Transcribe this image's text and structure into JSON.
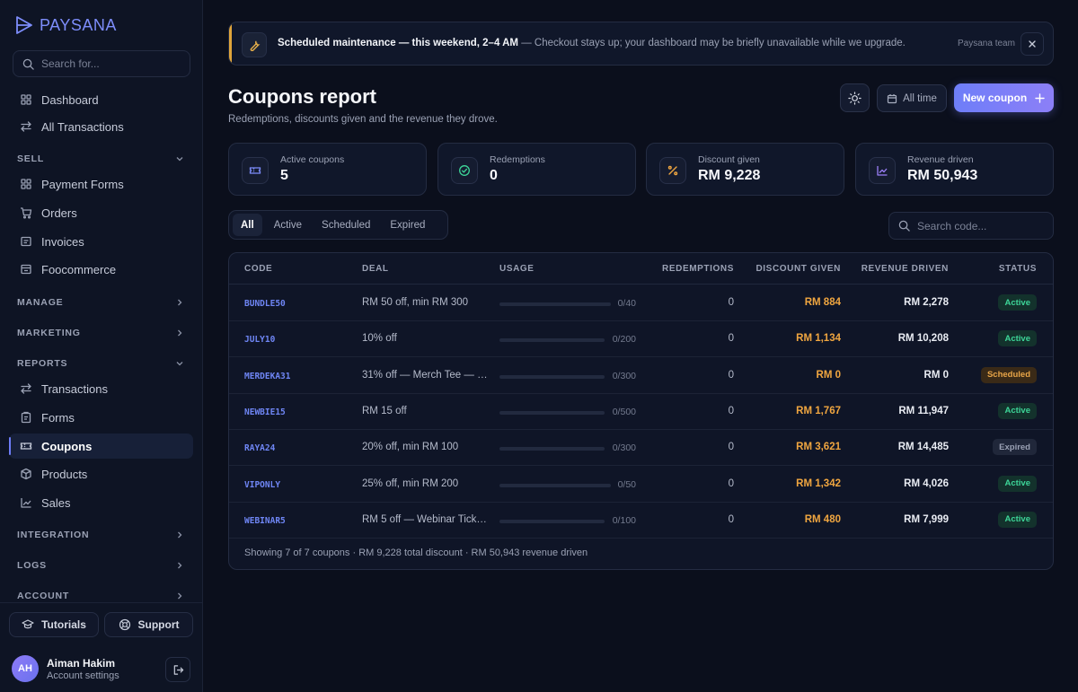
{
  "brand": {
    "name": "PAYSANA"
  },
  "sidebar": {
    "search_placeholder": "Search for...",
    "top_items": [
      {
        "label": "Dashboard",
        "icon": "grid-icon"
      },
      {
        "label": "All Transactions",
        "icon": "swap-icon"
      }
    ],
    "sections": {
      "sell": "SELL",
      "manage": "MANAGE",
      "marketing": "MARKETING",
      "reports": "REPORTS",
      "integration": "INTEGRATION",
      "logs": "LOGS",
      "account": "ACCOUNT"
    },
    "sell_items": [
      {
        "label": "Payment Forms",
        "icon": "grid-icon"
      },
      {
        "label": "Orders",
        "icon": "cart-icon"
      },
      {
        "label": "Invoices",
        "icon": "invoice-icon"
      },
      {
        "label": "Foocommerce",
        "icon": "store-icon"
      }
    ],
    "report_items": [
      {
        "label": "Transactions",
        "icon": "swap-icon"
      },
      {
        "label": "Forms",
        "icon": "clipboard-icon"
      },
      {
        "label": "Coupons",
        "icon": "ticket-icon",
        "active": true
      },
      {
        "label": "Products",
        "icon": "box-icon"
      },
      {
        "label": "Sales",
        "icon": "chart-line-icon"
      }
    ],
    "tutorials_label": "Tutorials",
    "support_label": "Support",
    "user": {
      "initials": "AH",
      "name": "Aiman Hakim",
      "subtitle": "Account settings"
    }
  },
  "banner": {
    "title": "Scheduled maintenance — this weekend, 2–4 AM",
    "message": " — Checkout stays up; your dashboard may be briefly unavailable while we upgrade.",
    "team": "Paysana team"
  },
  "header": {
    "title": "Coupons report",
    "subtitle": "Redemptions, discounts given and the revenue they drove.",
    "time_filter": "All time",
    "new_button": "New coupon"
  },
  "stats": [
    {
      "label": "Active coupons",
      "value": "5",
      "icon": "ticket-icon",
      "color": "#7d8dfb"
    },
    {
      "label": "Redemptions",
      "value": "0",
      "icon": "check-circle-icon",
      "color": "#3dd598"
    },
    {
      "label": "Discount given",
      "value": "RM 9,228",
      "icon": "percent-icon",
      "color": "#f0a640"
    },
    {
      "label": "Revenue driven",
      "value": "RM 50,943",
      "icon": "trend-icon",
      "color": "#9b7ff7"
    }
  ],
  "tabs": [
    "All",
    "Active",
    "Scheduled",
    "Expired"
  ],
  "code_search_placeholder": "Search code...",
  "table": {
    "columns": [
      "CODE",
      "DEAL",
      "USAGE",
      "REDEMPTIONS",
      "DISCOUNT GIVEN",
      "REVENUE DRIVEN",
      "STATUS"
    ],
    "rows": [
      {
        "code": "BUNDLE50",
        "deal": "RM 50 off, min RM 300",
        "usage": "0/40",
        "usage_fraction": 0,
        "redemptions": "0",
        "discount": "RM 884",
        "revenue": "RM 2,278",
        "status": "Active"
      },
      {
        "code": "JULY10",
        "deal": "10% off",
        "usage": "0/200",
        "usage_fraction": 0,
        "redemptions": "0",
        "discount": "RM 1,134",
        "revenue": "RM 10,208",
        "status": "Active"
      },
      {
        "code": "MERDEKA31",
        "deal": "31% off — Merch Tee — Pa...",
        "usage": "0/300",
        "usage_fraction": 0,
        "redemptions": "0",
        "discount": "RM 0",
        "revenue": "RM 0",
        "status": "Scheduled"
      },
      {
        "code": "NEWBIE15",
        "deal": "RM 15 off",
        "usage": "0/500",
        "usage_fraction": 0,
        "redemptions": "0",
        "discount": "RM 1,767",
        "revenue": "RM 11,947",
        "status": "Active"
      },
      {
        "code": "RAYA24",
        "deal": "20% off, min RM 100",
        "usage": "0/300",
        "usage_fraction": 0,
        "redemptions": "0",
        "discount": "RM 3,621",
        "revenue": "RM 14,485",
        "status": "Expired"
      },
      {
        "code": "VIPONLY",
        "deal": "25% off, min RM 200",
        "usage": "0/50",
        "usage_fraction": 0,
        "redemptions": "0",
        "discount": "RM 1,342",
        "revenue": "RM 4,026",
        "status": "Active"
      },
      {
        "code": "WEBINAR5",
        "deal": "RM 5 off — Webinar Ticket...",
        "usage": "0/100",
        "usage_fraction": 0,
        "redemptions": "0",
        "discount": "RM 480",
        "revenue": "RM 7,999",
        "status": "Active"
      }
    ],
    "footer": "Showing 7 of 7 coupons · RM 9,228 total discount · RM 50,943 revenue driven"
  }
}
